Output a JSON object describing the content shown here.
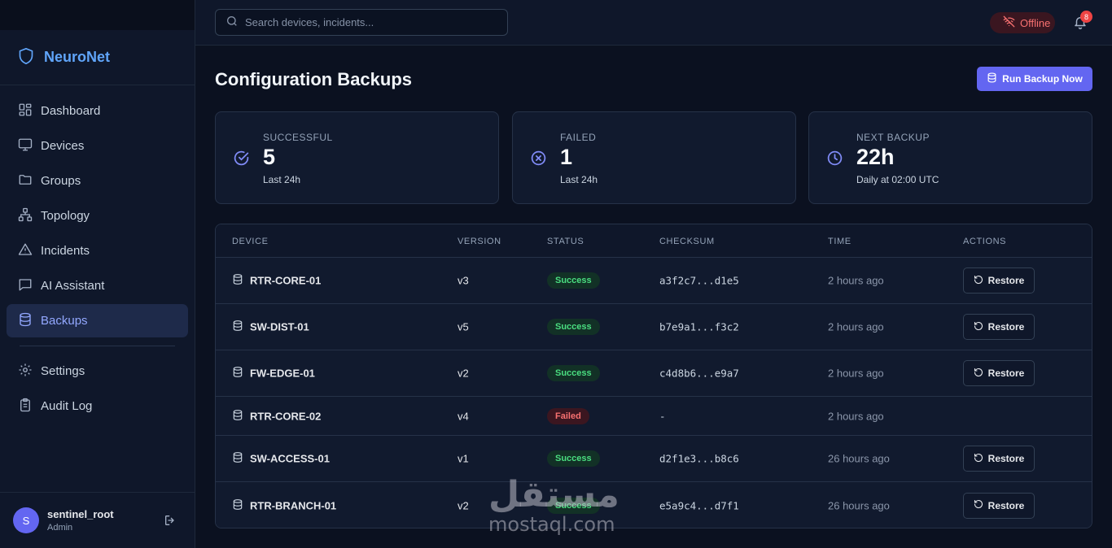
{
  "app": {
    "name": "NeuroNet"
  },
  "sidebar": {
    "items": [
      {
        "label": "Dashboard",
        "icon": "dashboard-icon"
      },
      {
        "label": "Devices",
        "icon": "monitor-icon"
      },
      {
        "label": "Groups",
        "icon": "folder-icon"
      },
      {
        "label": "Topology",
        "icon": "network-icon"
      },
      {
        "label": "Incidents",
        "icon": "alert-triangle-icon"
      },
      {
        "label": "AI Assistant",
        "icon": "chat-icon"
      },
      {
        "label": "Backups",
        "icon": "database-icon",
        "active": true
      }
    ],
    "secondary": [
      {
        "label": "Settings",
        "icon": "gear-icon"
      },
      {
        "label": "Audit Log",
        "icon": "clipboard-icon"
      }
    ]
  },
  "user": {
    "initial": "S",
    "name": "sentinel_root",
    "role": "Admin"
  },
  "topbar": {
    "search_placeholder": "Search devices, incidents...",
    "status_label": "Offline",
    "notification_count": "8"
  },
  "page": {
    "title": "Configuration Backups",
    "run_button": "Run Backup Now"
  },
  "cards": [
    {
      "label": "SUCCESSFUL",
      "value": "5",
      "sub": "Last 24h",
      "icon": "check-circle-icon"
    },
    {
      "label": "FAILED",
      "value": "1",
      "sub": "Last 24h",
      "icon": "x-circle-icon"
    },
    {
      "label": "NEXT BACKUP",
      "value": "22h",
      "sub": "Daily at 02:00 UTC",
      "icon": "clock-icon"
    }
  ],
  "table": {
    "headers": [
      "DEVICE",
      "VERSION",
      "STATUS",
      "CHECKSUM",
      "TIME",
      "ACTIONS"
    ],
    "restore_label": "Restore",
    "rows": [
      {
        "device": "RTR-CORE-01",
        "version": "v3",
        "status": "Success",
        "checksum": "a3f2c7...d1e5",
        "time": "2 hours ago"
      },
      {
        "device": "SW-DIST-01",
        "version": "v5",
        "status": "Success",
        "checksum": "b7e9a1...f3c2",
        "time": "2 hours ago"
      },
      {
        "device": "FW-EDGE-01",
        "version": "v2",
        "status": "Success",
        "checksum": "c4d8b6...e9a7",
        "time": "2 hours ago"
      },
      {
        "device": "RTR-CORE-02",
        "version": "v4",
        "status": "Failed",
        "checksum": "-",
        "time": "2 hours ago"
      },
      {
        "device": "SW-ACCESS-01",
        "version": "v1",
        "status": "Success",
        "checksum": "d2f1e3...b8c6",
        "time": "26 hours ago"
      },
      {
        "device": "RTR-BRANCH-01",
        "version": "v2",
        "status": "Success",
        "checksum": "e5a9c4...d7f1",
        "time": "26 hours ago"
      }
    ]
  },
  "watermark": {
    "arabic": "مستقل",
    "latin": "mostaql.com"
  },
  "colors": {
    "accent": "#6366f1",
    "brand": "#60a5fa",
    "success": "#4ade80",
    "danger": "#f87171"
  }
}
